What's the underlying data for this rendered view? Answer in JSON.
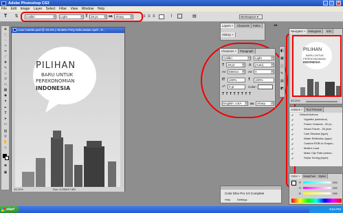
{
  "window": {
    "title": "Adobe Photoshop CS3",
    "min": "_",
    "max": "□",
    "close": "×"
  },
  "menu": [
    "File",
    "Edit",
    "Image",
    "Layer",
    "Select",
    "Filter",
    "View",
    "Window",
    "Help"
  ],
  "options_bar": {
    "font_family": "Calibri",
    "font_style": "Light",
    "font_size": "28 pt",
    "antialias": "Sharp",
    "workspace": "Workspace ▾"
  },
  "document": {
    "title": "cover buletin.psd @ 33.2% (~Buletin PSQ Edisi Bulan April-, R...",
    "zoom": "33.22%",
    "doc_size": "Doc: 6.20M/17.6M",
    "cover_line1": "PILIHAN",
    "cover_line2": "BARU UNTUK",
    "cover_line3": "PEREKONOMIAN",
    "cover_line4": "INDONESIA"
  },
  "layers_panel": {
    "tabs": [
      "Layers ×",
      "Channels",
      "Paths"
    ],
    "history": "History ×"
  },
  "character_panel": {
    "tabs": [
      "Character ×",
      "Paragraph"
    ],
    "font_family": "Calibri",
    "font_style": "Light",
    "size": "28 pt",
    "leading": "(Auto)",
    "kerning": "Metrics",
    "tracking": "0",
    "vscale": "100%",
    "hscale": "100%",
    "baseline": "0 pt",
    "color_label": "Color:",
    "language": "English: USA",
    "antialias": "Sharp"
  },
  "navigator": {
    "tabs": [
      "Navigator ×",
      "Histogram",
      "Info"
    ],
    "zoom": "33.22%",
    "line1": "PILIHAN",
    "line2": "BARU UNTUK",
    "line3": "PEREKONOMIAN",
    "line4": "INDONESIA"
  },
  "actions_panel": {
    "tabs": [
      "Actions ×",
      "Tool Presets"
    ],
    "items": [
      "Default Actions",
      "Vignette (selection)",
      "Frame Channel - 50 pi...",
      "Wood Frame - 50 pixel",
      "Cast Shadow (type)",
      "Water Reflection (type)",
      "Custom RGB to Graysc...",
      "Molten Lead",
      "Make Clip Path (select...",
      "Sepia Toning (layer)"
    ]
  },
  "color_panel": {
    "tabs": [
      "Color ×",
      "Swatches",
      "Styles"
    ],
    "channels": [
      {
        "label": "R",
        "value": "255"
      },
      {
        "label": "G",
        "value": "255"
      },
      {
        "label": "B",
        "value": "255"
      }
    ]
  },
  "color_efex": {
    "title": "Color Efex Pro 3.0 Complete",
    "help": "Help",
    "settings": "Settings"
  },
  "taskbar": {
    "start": "start",
    "clock": "8:54 PM"
  },
  "colors": {
    "accent_red": "#e00000",
    "xp_blue": "#245ad3"
  }
}
